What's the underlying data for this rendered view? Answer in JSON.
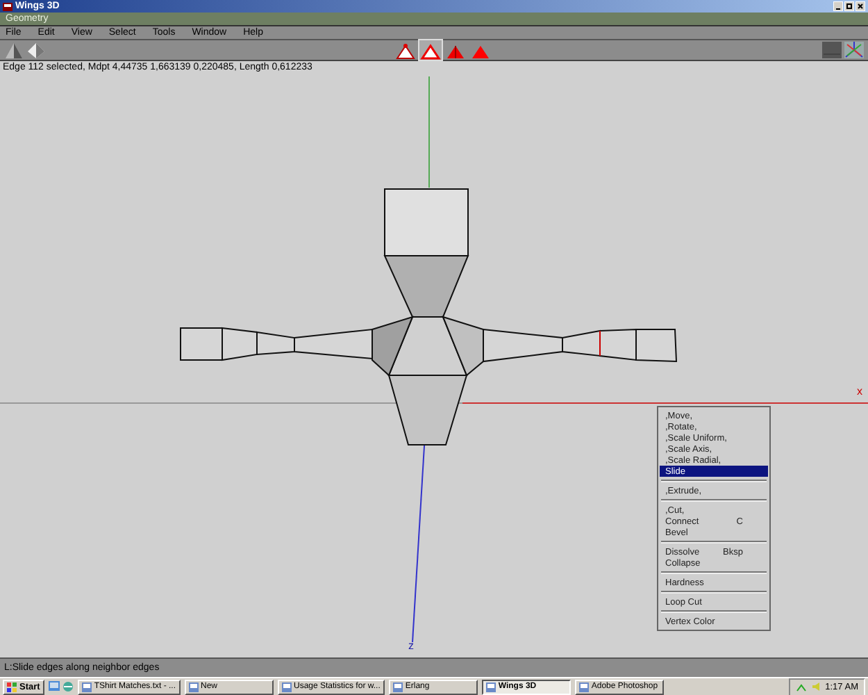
{
  "window": {
    "title": "Wings 3D"
  },
  "geometry_bar": {
    "title": "Geometry"
  },
  "menu_bar": [
    "File",
    "Edit",
    "View",
    "Select",
    "Tools",
    "Window",
    "Help"
  ],
  "toolbar": {
    "selection_modes": [
      {
        "kind": "vertex",
        "selected": false
      },
      {
        "kind": "edge",
        "selected": true
      },
      {
        "kind": "face",
        "selected": false
      },
      {
        "kind": "body",
        "selected": false
      }
    ]
  },
  "info_line": "Edge 112 selected, Mdpt 4,44735 1,663139 0,220485, Length 0,612233",
  "viewport": {
    "axis_labels": [
      {
        "kind": "x",
        "text": "x"
      },
      {
        "kind": "z",
        "text": "z"
      }
    ]
  },
  "context_menu": [
    {
      "kind": "item",
      "label": ",Move,",
      "selected": false
    },
    {
      "kind": "item",
      "label": ",Rotate,",
      "selected": false
    },
    {
      "kind": "item",
      "label": ",Scale Uniform,",
      "selected": false
    },
    {
      "kind": "item",
      "label": ",Scale Axis,",
      "selected": false
    },
    {
      "kind": "item",
      "label": ",Scale Radial,",
      "selected": false
    },
    {
      "kind": "item",
      "label": "Slide",
      "selected": true
    },
    {
      "kind": "separator"
    },
    {
      "kind": "item",
      "label": ",Extrude,",
      "selected": false
    },
    {
      "kind": "separator"
    },
    {
      "kind": "item",
      "label": ",Cut,",
      "selected": false
    },
    {
      "kind": "item",
      "label": "Connect",
      "shortcut": "C",
      "selected": false
    },
    {
      "kind": "item",
      "label": "Bevel",
      "selected": false
    },
    {
      "kind": "separator"
    },
    {
      "kind": "item",
      "label": "Dissolve",
      "shortcut": "Bksp",
      "selected": false
    },
    {
      "kind": "item",
      "label": "Collapse",
      "selected": false
    },
    {
      "kind": "separator"
    },
    {
      "kind": "item",
      "label": "Hardness",
      "selected": false
    },
    {
      "kind": "separator"
    },
    {
      "kind": "item",
      "label": "Loop Cut",
      "selected": false
    },
    {
      "kind": "separator"
    },
    {
      "kind": "item",
      "label": "Vertex Color",
      "selected": false
    }
  ],
  "status_bar": "L:Slide edges along neighbor edges",
  "taskbar": {
    "start": "Start",
    "tasks": [
      {
        "label": "TShirt Matches.txt - ...",
        "selected": false
      },
      {
        "label": "New",
        "selected": false
      },
      {
        "label": "Usage Statistics for w...",
        "selected": false
      },
      {
        "label": "Erlang",
        "selected": false
      },
      {
        "label": "Wings 3D",
        "selected": true
      },
      {
        "label": "Adobe Photoshop",
        "selected": false
      }
    ],
    "clock": "1:17 AM"
  }
}
